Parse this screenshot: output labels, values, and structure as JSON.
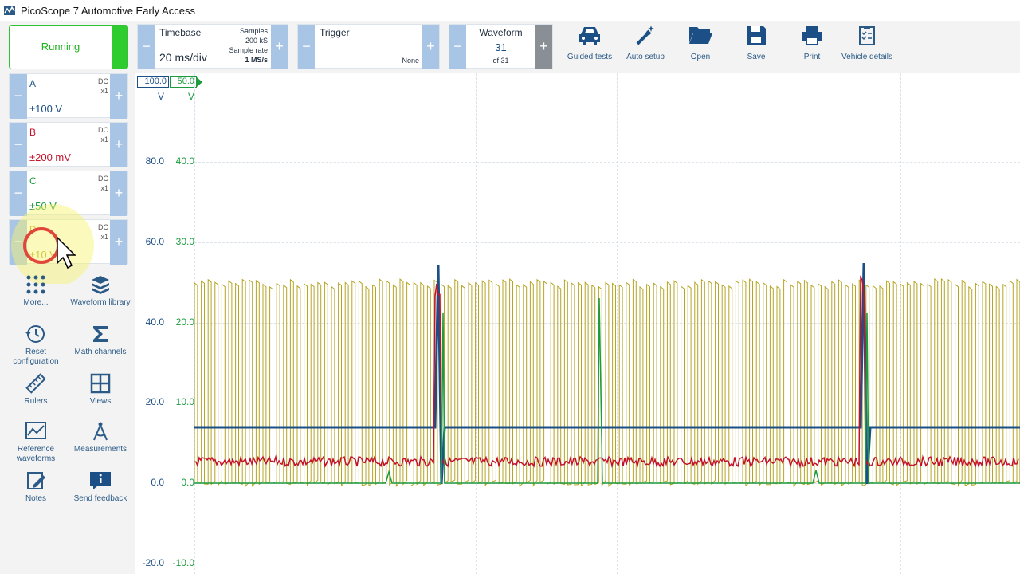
{
  "app": {
    "title": "PicoScope 7 Automotive Early Access"
  },
  "run": {
    "label": "Running"
  },
  "channels": [
    {
      "name": "A",
      "coupling": "DC",
      "probe": "x1",
      "range": "±100 V",
      "color": "#1c4f86"
    },
    {
      "name": "B",
      "coupling": "DC",
      "probe": "x1",
      "range": "±200 mV",
      "color": "#c4112a"
    },
    {
      "name": "C",
      "coupling": "DC",
      "probe": "x1",
      "range": "±50 V",
      "color": "#1c9b3f"
    },
    {
      "name": "D",
      "coupling": "DC",
      "probe": "x1",
      "range": "±10 V",
      "color": "#b6a423"
    }
  ],
  "tools": {
    "more": "More...",
    "waveform_library": "Waveform library",
    "reset": "Reset configuration",
    "math": "Math channels",
    "rulers": "Rulers",
    "views": "Views",
    "reference": "Reference waveforms",
    "measurements": "Measurements",
    "notes": "Notes",
    "feedback": "Send feedback"
  },
  "timebase": {
    "label": "Timebase",
    "value": "20 ms/div",
    "samples_label": "Samples",
    "samples_value": "200 kS",
    "rate_label": "Sample rate",
    "rate_value": "1 MS/s"
  },
  "trigger": {
    "label": "Trigger",
    "mode": "None"
  },
  "waveform": {
    "label": "Waveform",
    "current": "31",
    "total": "of 31"
  },
  "toolbar": {
    "guided": "Guided tests",
    "auto": "Auto setup",
    "open": "Open",
    "save": "Save",
    "print": "Print",
    "vehicle": "Vehicle details"
  },
  "axes": {
    "a_top": "100.0",
    "a_unit": "V",
    "c_top": "50.0",
    "c_unit": "V",
    "a_ticks": [
      "80.0",
      "60.0",
      "40.0",
      "20.0",
      "0.0",
      "-20.0"
    ],
    "c_ticks": [
      "40.0",
      "30.0",
      "20.0",
      "10.0",
      "0.0",
      "-10.0"
    ]
  },
  "colors": {
    "accent": "#a9c5e5",
    "running": "#2ecc2e",
    "chanA": "#1c4f86",
    "chanB": "#c4112a",
    "chanC": "#1c9b3f",
    "chanD": "#b6a423"
  }
}
